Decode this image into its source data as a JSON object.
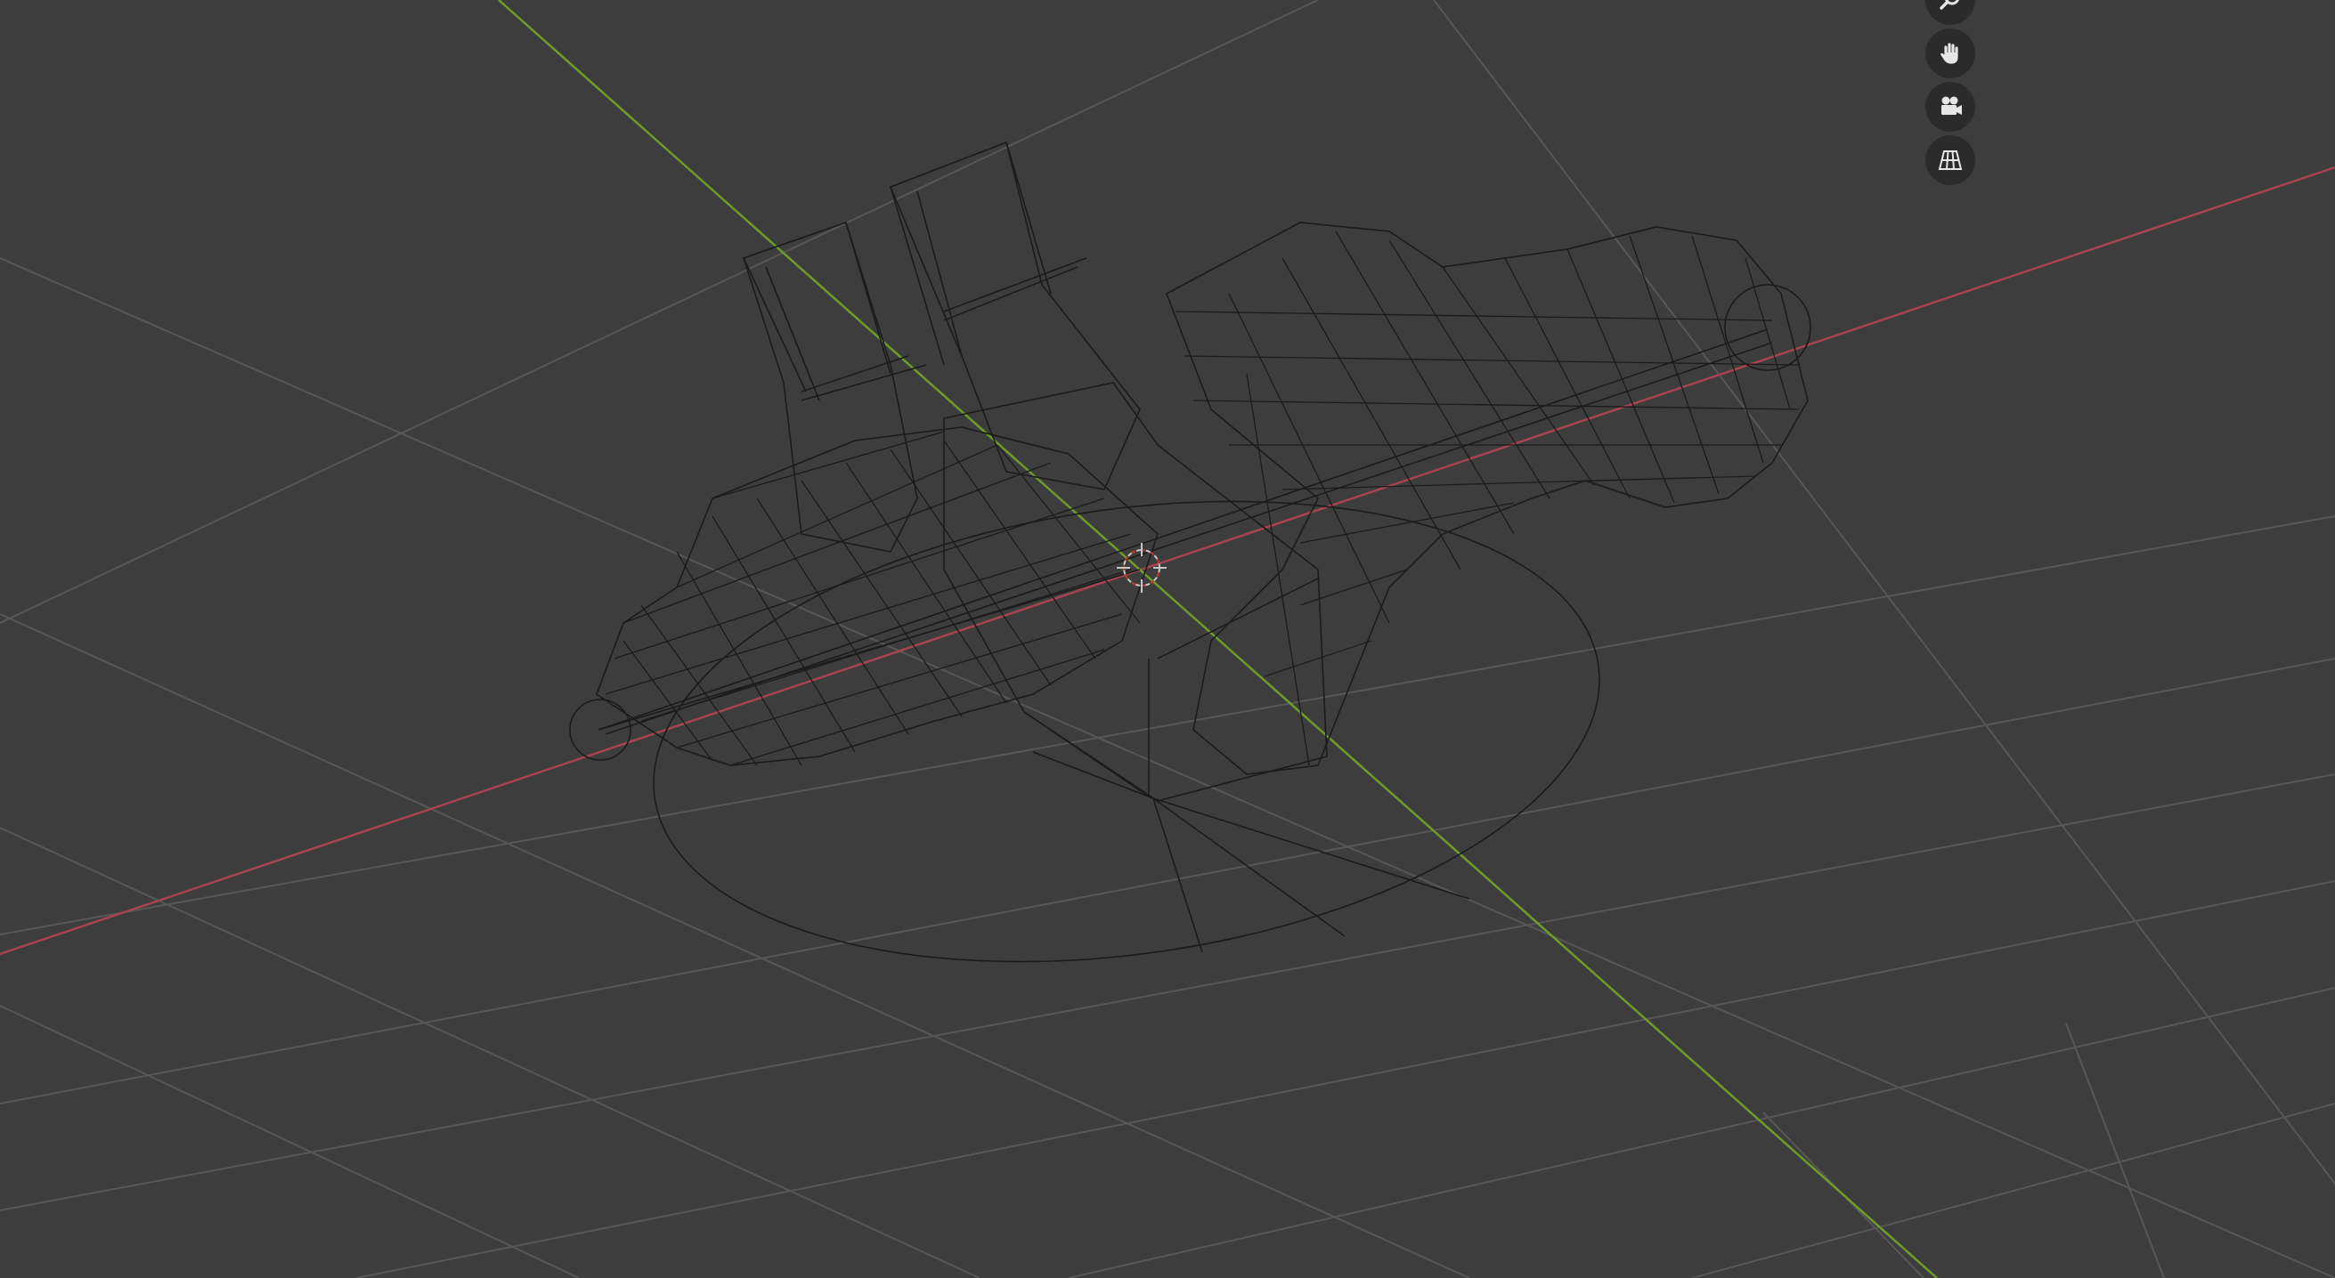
{
  "viewport": {
    "mode": "wireframe",
    "background_color": "#3d3d3d",
    "grid_color": "#575757",
    "x_axis_color": "#a84451",
    "y_axis_color": "#6f9b2a",
    "wire_color": "#1b1b1b",
    "cursor_color": "#c8c8c8",
    "cursor_accent_color": "#c0392b"
  },
  "navigation_gizmo": {
    "buttons": [
      {
        "name": "zoom",
        "icon": "magnifier-icon"
      },
      {
        "name": "pan",
        "icon": "hand-icon"
      },
      {
        "name": "camera-view",
        "icon": "camera-icon"
      },
      {
        "name": "perspective-toggle",
        "icon": "grid-perspective-icon"
      }
    ]
  }
}
